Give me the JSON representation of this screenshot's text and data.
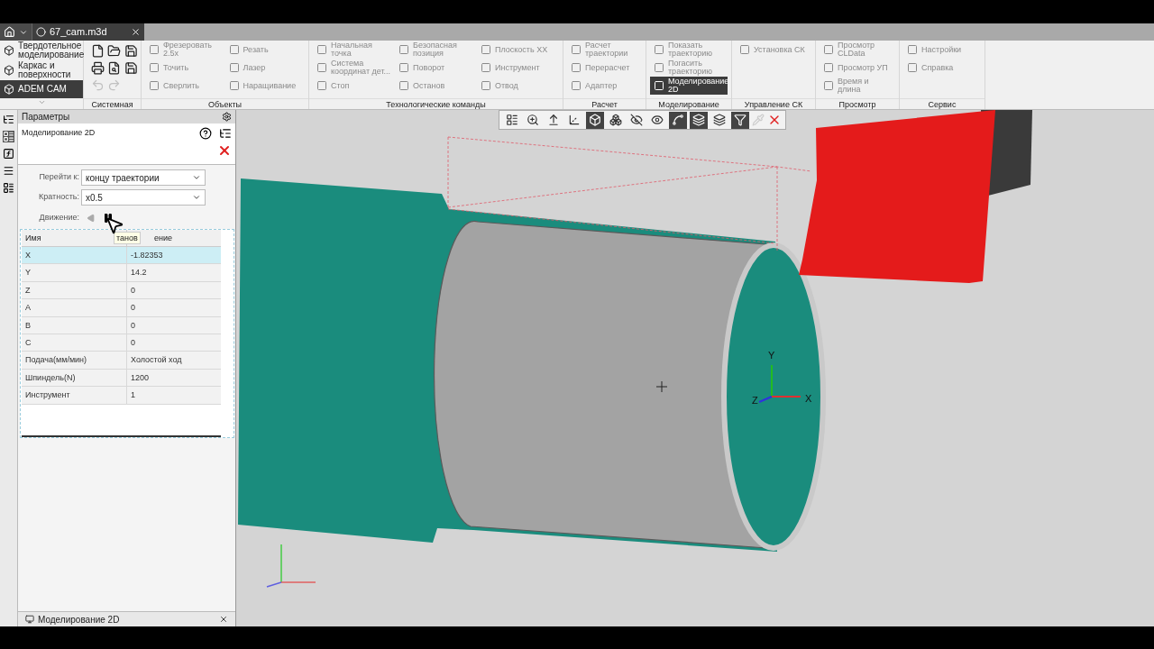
{
  "tab": {
    "title": "67_cam.m3d"
  },
  "modes": [
    {
      "label": "Твердотельное моделирование",
      "selected": false
    },
    {
      "label": "Каркас и поверхности",
      "selected": false
    },
    {
      "label": "ADEM CAM",
      "selected": true
    }
  ],
  "ribbon_groups": [
    {
      "title": "Системная",
      "kind": "system"
    },
    {
      "title": "Объекты",
      "kind": "commands",
      "items": [
        {
          "label": "Фрезеровать 2.5x",
          "disabled": true
        },
        {
          "label": "Точить",
          "disabled": true
        },
        {
          "label": "Сверлить",
          "disabled": true
        },
        {
          "label": "Резать",
          "disabled": true
        },
        {
          "label": "Лазер",
          "disabled": true
        },
        {
          "label": "Наращивание",
          "disabled": true
        }
      ]
    },
    {
      "title": "Технологические команды",
      "kind": "commands",
      "items": [
        {
          "label": "Начальная точка",
          "disabled": true
        },
        {
          "label": "Система координат дет...",
          "disabled": true
        },
        {
          "label": "Стоп",
          "disabled": true
        },
        {
          "label": "Безопасная позиция",
          "disabled": true
        },
        {
          "label": "Поворот",
          "disabled": true
        },
        {
          "label": "Останов",
          "disabled": true
        },
        {
          "label": "Плоскость XX",
          "disabled": true
        },
        {
          "label": "Инструмент",
          "disabled": true
        },
        {
          "label": "Отвод",
          "disabled": true
        }
      ]
    },
    {
      "title": "Расчет",
      "kind": "commands",
      "items": [
        {
          "label": "Расчет траектории",
          "disabled": true
        },
        {
          "label": "Перерасчет",
          "disabled": true
        },
        {
          "label": "Адаптер",
          "disabled": true
        }
      ]
    },
    {
      "title": "Моделирование",
      "kind": "commands",
      "items": [
        {
          "label": "Показать траекторию",
          "disabled": true
        },
        {
          "label": "Погасить траекторию",
          "disabled": true
        },
        {
          "label": "Моделирование 2D",
          "disabled": false,
          "selected": true
        }
      ]
    },
    {
      "title": "Управление СК",
      "kind": "commands",
      "items": [
        {
          "label": "Установка СК",
          "disabled": true
        }
      ]
    },
    {
      "title": "Просмотр",
      "kind": "commands",
      "items": [
        {
          "label": "Просмотр CLData",
          "disabled": true
        },
        {
          "label": "Просмотр УП",
          "disabled": true
        },
        {
          "label": "Время и длина",
          "disabled": true
        }
      ]
    },
    {
      "title": "Сервис",
      "kind": "commands",
      "items": [
        {
          "label": "Настройки",
          "disabled": true
        },
        {
          "label": "Справка",
          "disabled": true
        }
      ]
    }
  ],
  "panel": {
    "title": "Параметры",
    "subtitle": "Моделирование 2D",
    "fields": [
      {
        "label": "Перейти к:",
        "value": "концу траектории"
      },
      {
        "label": "Кратность:",
        "value": "x0.5"
      }
    ],
    "motion_label": "Движение:",
    "tooltip": "танов",
    "columns": [
      "Имя",
      "ение"
    ],
    "rows": [
      {
        "name": "X",
        "value": "-1.82353",
        "selected": true
      },
      {
        "name": "Y",
        "value": "14.2",
        "selected": false
      },
      {
        "name": "Z",
        "value": "0",
        "selected": false
      },
      {
        "name": "A",
        "value": "0",
        "selected": false
      },
      {
        "name": "B",
        "value": "0",
        "selected": false
      },
      {
        "name": "C",
        "value": "0",
        "selected": false
      },
      {
        "name": "Подача(мм/мин)",
        "value": "Холостой ход",
        "selected": false
      },
      {
        "name": "Шпиндель(N)",
        "value": "1200",
        "selected": false
      },
      {
        "name": "Инструмент",
        "value": "1",
        "selected": false
      }
    ],
    "bottom_tab": "Моделирование 2D"
  },
  "view_toolbar": [
    {
      "selected": false
    },
    {
      "selected": false
    },
    {
      "selected": false
    },
    {
      "selected": false
    },
    {
      "selected": true
    },
    {
      "selected": false
    },
    {
      "selected": false
    },
    {
      "selected": false
    },
    {
      "selected": true
    },
    {
      "selected": true
    },
    {
      "selected": false
    },
    {
      "selected": true
    }
  ],
  "viewport": {
    "axis_labels": [
      "Y",
      "Z",
      "X"
    ]
  }
}
